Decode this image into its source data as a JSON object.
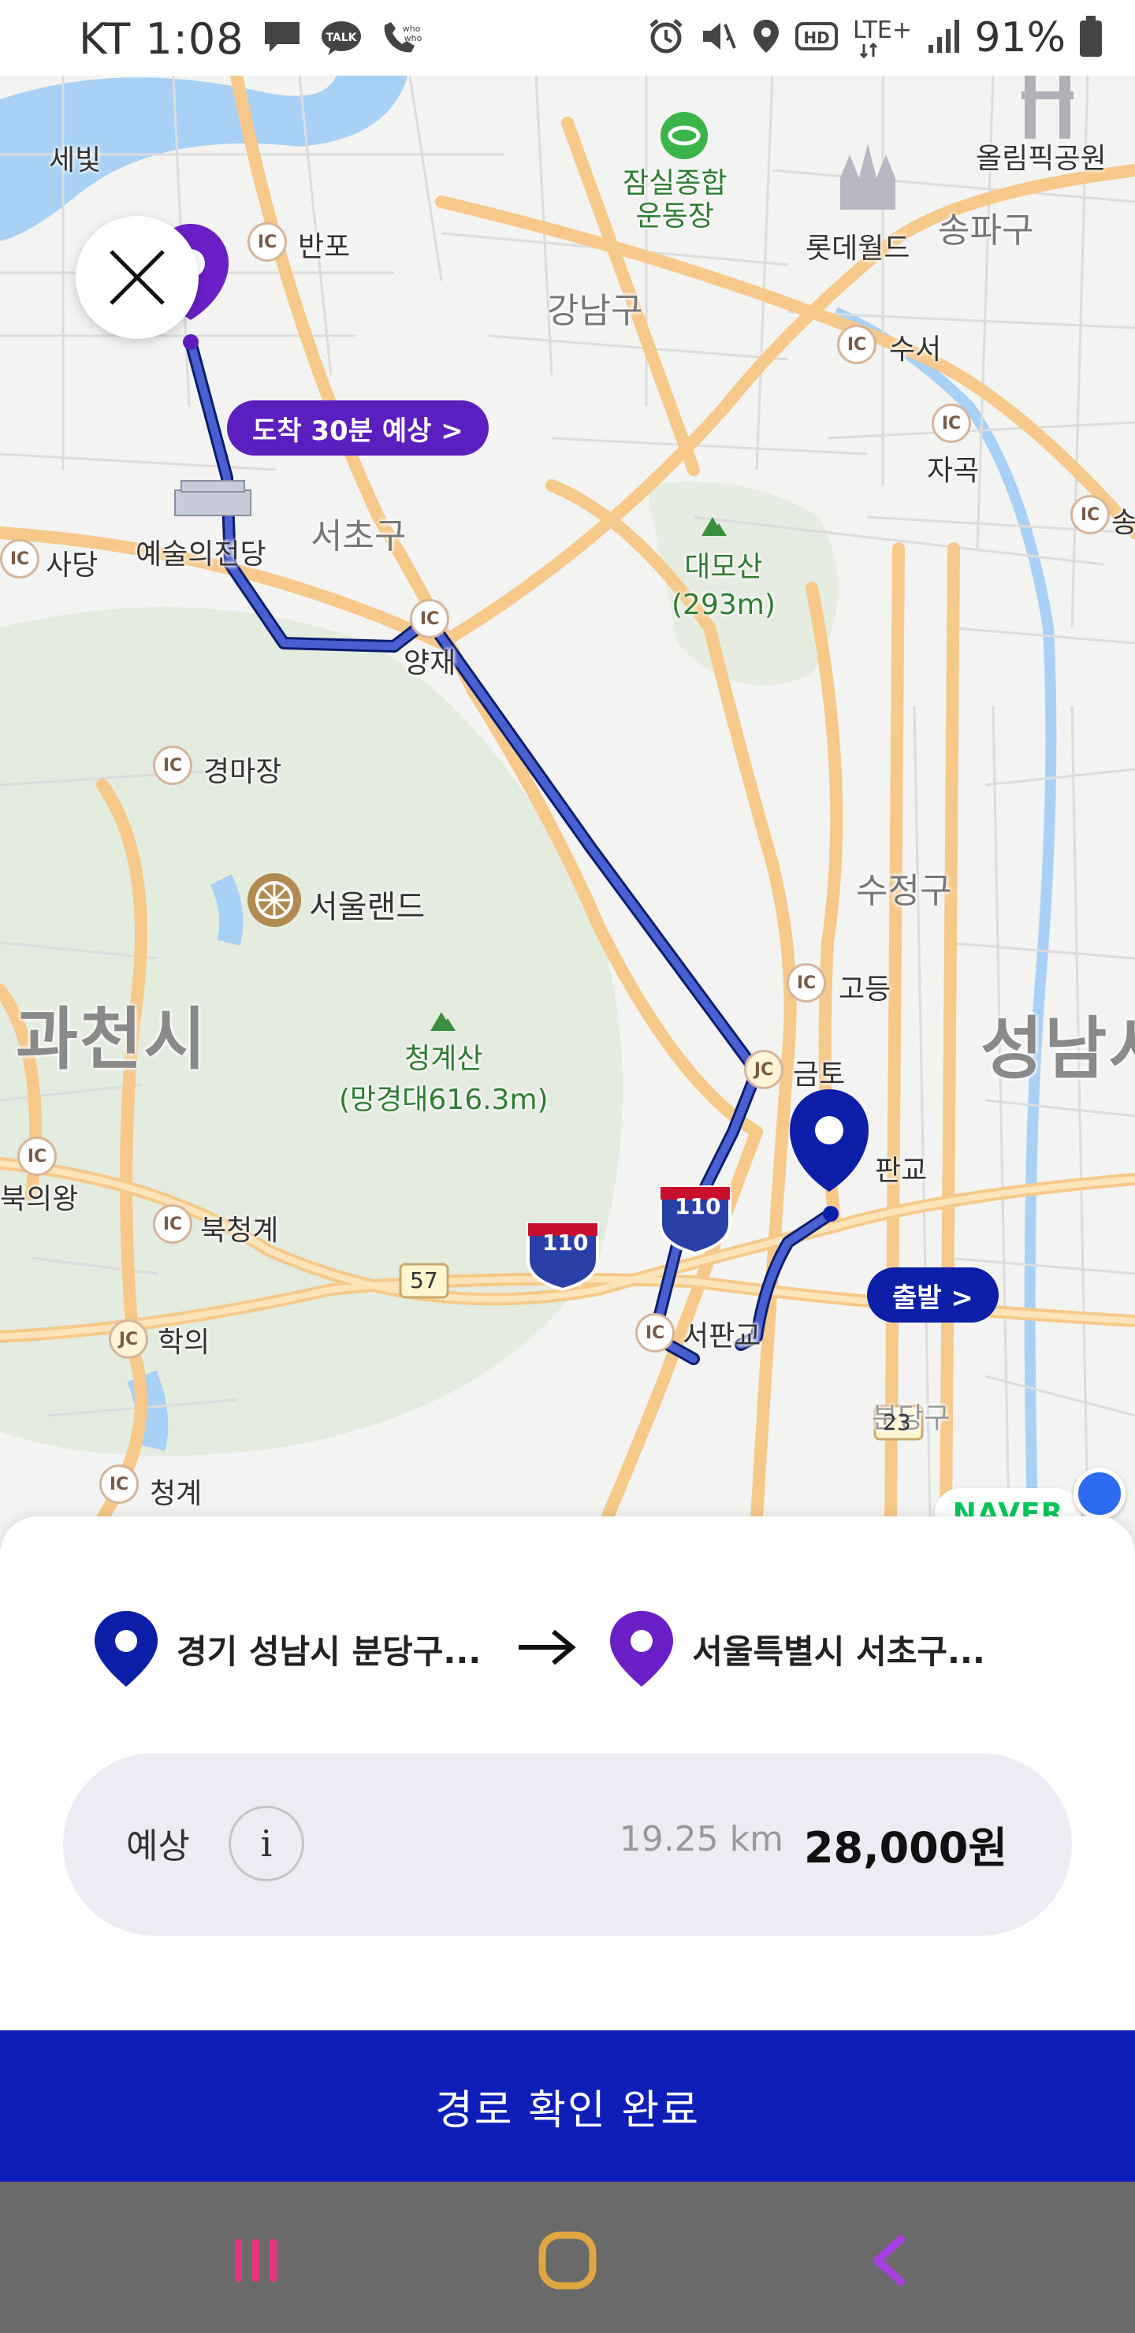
{
  "status_bar": {
    "carrier_time": "KT 1:08",
    "icons": [
      "message-icon",
      "talk-icon",
      "whowho-icon",
      "alarm-icon",
      "mute-icon",
      "location-icon",
      "hd-icon",
      "lte-icon",
      "signal-icon",
      "battery-icon"
    ],
    "hd_text": "HD",
    "lte_text": "LTE+",
    "battery_percent": "91%"
  },
  "map": {
    "labels": {
      "sebit": "세빛",
      "banpo": "반포",
      "jamsil": "잠실종합\n운동장",
      "lotteworld": "롯데월드",
      "olympic": "올림픽공원",
      "songpa": "송파구",
      "gangnam": "강남구",
      "suseo": "수서",
      "jagok": "자곡",
      "seocho_ic": "서초",
      "seocho_gu": "서초구",
      "arts_center": "예술의전당",
      "sadang": "사당",
      "daemosan": "대모산\n(293m)",
      "yangjae": "양재",
      "gyeongmajang": "경마장",
      "seoulland": "서울랜드",
      "sujeong": "수정구",
      "gwacheon": "과천시",
      "cheonggyesan": "청계산\n(망경대616.3m)",
      "godeung": "고등",
      "geumto": "금토",
      "seongnam": "성남시",
      "pangyo": "판교",
      "buguiwang": "북의왕",
      "bukcheonggye": "북청계",
      "hakui": "학의",
      "seopangyo": "서판교",
      "cheonggye": "청계",
      "song_partial": "송",
      "bundang_partial": "분당구",
      "route_57": "57",
      "route_110a": "110",
      "route_110b": "110",
      "route_23": "23",
      "ic": "IC",
      "jc": "JC"
    },
    "arrival_pill": "도착 30분 예상 >",
    "depart_pill": "출발 >",
    "provider": "NAVER",
    "colors": {
      "route_line": "#4a5fd0",
      "arrival_marker": "#6a1fc7",
      "depart_marker": "#0d1fa8",
      "road": "#f9cf8f"
    }
  },
  "sheet": {
    "origin": "경기 성남시 분당구...",
    "destination": "서울특별시 서초구...",
    "fare_label": "예상",
    "info_icon": "i",
    "distance": "19.25 km",
    "price": "28,000원"
  },
  "confirm_button": "경로 확인 완료",
  "nav": {
    "recent": "recent-apps-icon",
    "home": "home-icon",
    "back": "back-icon"
  }
}
